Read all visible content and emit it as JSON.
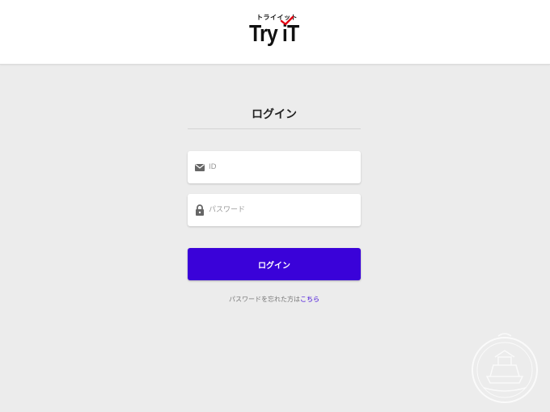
{
  "brand": {
    "kana": "トライイット",
    "name": "Try iT",
    "check_color": "#e00010"
  },
  "login": {
    "title": "ログイン",
    "id_placeholder": "ID",
    "password_placeholder": "パスワード",
    "submit_label": "ログイン",
    "forgot_text": "パスワードを忘れた方は",
    "forgot_link": "こちら",
    "accent_color": "#3a02d9"
  },
  "icons": {
    "id_field": "envelope-icon",
    "password_field": "lock-icon"
  }
}
